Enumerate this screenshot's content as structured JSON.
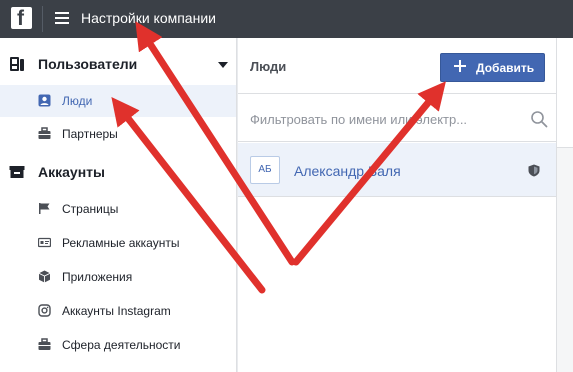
{
  "app": {
    "logo_letter": "f",
    "title": "Настройки компании"
  },
  "sidebar": {
    "users_section": {
      "label": "Пользователи",
      "items": [
        {
          "label": "Люди",
          "icon": "person-badge-icon",
          "active": true
        },
        {
          "label": "Партнеры",
          "icon": "briefcase-icon",
          "active": false
        }
      ]
    },
    "accounts_section": {
      "label": "Аккаунты",
      "items": [
        {
          "label": "Страницы",
          "icon": "flag-icon"
        },
        {
          "label": "Рекламные аккаунты",
          "icon": "ad-account-icon"
        },
        {
          "label": "Приложения",
          "icon": "cube-icon"
        },
        {
          "label": "Аккаунты Instagram",
          "icon": "instagram-icon"
        },
        {
          "label": "Сфера деятельности",
          "icon": "briefcase-icon"
        }
      ]
    }
  },
  "main": {
    "title": "Люди",
    "add_button_label": "Добавить",
    "filter_placeholder": "Фильтровать по имени или электр...",
    "people": [
      {
        "initials": "АБ",
        "name": "Александр Баля"
      }
    ]
  },
  "colors": {
    "topbar": "#3b4047",
    "accent": "#4267b2",
    "selected_row": "#edf2fa",
    "annotation_arrow": "#e0312c"
  }
}
